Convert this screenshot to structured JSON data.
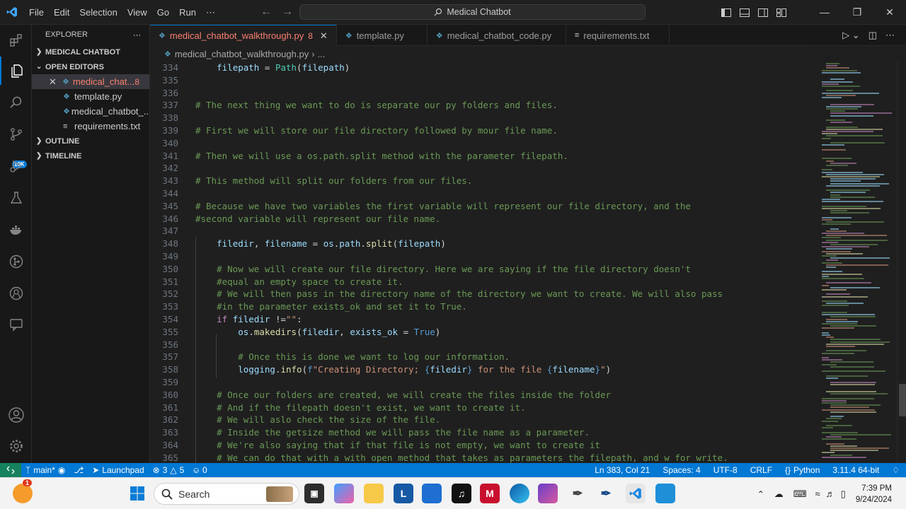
{
  "titlebar": {
    "menu": [
      "File",
      "Edit",
      "Selection",
      "View",
      "Go",
      "Run",
      "⋯"
    ],
    "search_text": "Medical Chatbot"
  },
  "explorer": {
    "title": "EXPLORER",
    "more": "⋯",
    "project": "MEDICAL CHATBOT",
    "open_editors": "OPEN EDITORS",
    "files": [
      {
        "name": "medical_chat...",
        "errors": "8"
      },
      {
        "name": "template.py"
      },
      {
        "name": "medical_chatbot_..."
      },
      {
        "name": "requirements.txt"
      }
    ],
    "outline": "OUTLINE",
    "timeline": "TIMELINE",
    "scm_badge": "10K"
  },
  "tabs": [
    {
      "label": "medical_chatbot_walkthrough.py",
      "errors": "8"
    },
    {
      "label": "template.py"
    },
    {
      "label": "medical_chatbot_code.py"
    },
    {
      "label": "requirements.txt"
    }
  ],
  "breadcrumb": {
    "file": "medical_chatbot_walkthrough.py",
    "sep": "›",
    "more": "..."
  },
  "code_lines": [
    {
      "n": "334",
      "t": "    filepath = Path(filepath)"
    },
    {
      "n": "335",
      "t": ""
    },
    {
      "n": "336",
      "t": ""
    },
    {
      "n": "337",
      "t": "# The next thing we want to do is separate our py folders and files."
    },
    {
      "n": "338",
      "t": ""
    },
    {
      "n": "339",
      "t": "# First we will store our file directory followed by mour file name."
    },
    {
      "n": "340",
      "t": ""
    },
    {
      "n": "341",
      "t": "# Then we will use a os.path.split method with the parameter filepath."
    },
    {
      "n": "342",
      "t": ""
    },
    {
      "n": "343",
      "t": "# This method will split our folders from our files."
    },
    {
      "n": "344",
      "t": ""
    },
    {
      "n": "345",
      "t": "# Because we have two variables the first variable will represent our file directory, and the"
    },
    {
      "n": "346",
      "t": "#second variable will represent our file name."
    },
    {
      "n": "347",
      "t": ""
    },
    {
      "n": "348",
      "t": "    filedir, filename = os.path.split(filepath)"
    },
    {
      "n": "349",
      "t": ""
    },
    {
      "n": "350",
      "t": "    # Now we will create our file directory. Here we are saying if the file directory doesn't"
    },
    {
      "n": "351",
      "t": "    #equal an empty space to create it."
    },
    {
      "n": "352",
      "t": "    # We will then pass in the directory name of the directory we want to create. We will also pass"
    },
    {
      "n": "353",
      "t": "    #in the parameter exists_ok and set it to True."
    },
    {
      "n": "354",
      "t": "    if filedir !=\"\":"
    },
    {
      "n": "355",
      "t": "        os.makedirs(filedir, exists_ok = True)"
    },
    {
      "n": "356",
      "t": ""
    },
    {
      "n": "357",
      "t": "        # Once this is done we want to log our information."
    },
    {
      "n": "358",
      "t": "        logging.info(f\"Creating Directory; {filedir} for the file {filename}\")"
    },
    {
      "n": "359",
      "t": ""
    },
    {
      "n": "360",
      "t": "    # Once our folders are created, we will create the files inside the folder"
    },
    {
      "n": "361",
      "t": "    # And if the filepath doesn't exist, we want to create it."
    },
    {
      "n": "362",
      "t": "    # We will aslo check the size of the file."
    },
    {
      "n": "363",
      "t": "    # Inside the getsize method we will pass the file name as a parameter."
    },
    {
      "n": "364",
      "t": "    # We're also saying that if that file is not empty, we want to create it"
    },
    {
      "n": "365",
      "t": "    # We can do that with a with open method that takes as parameters the filepath, and w for write."
    }
  ],
  "statusbar": {
    "branch": "main*",
    "launchpad": "Launchpad",
    "errors": "3",
    "warnings": "5",
    "ports": "0",
    "position": "Ln 383, Col 21",
    "spaces": "Spaces: 4",
    "encoding": "UTF-8",
    "eol": "CRLF",
    "language": "Python",
    "interpreter": "3.11.4 64-bit"
  },
  "taskbar": {
    "search_placeholder": "Search",
    "weather_badge": "1",
    "time": "7:39 PM",
    "date": "9/24/2024"
  },
  "colors": {
    "accent": "#0078d4",
    "error": "#f88070",
    "comment": "#6a9955"
  }
}
